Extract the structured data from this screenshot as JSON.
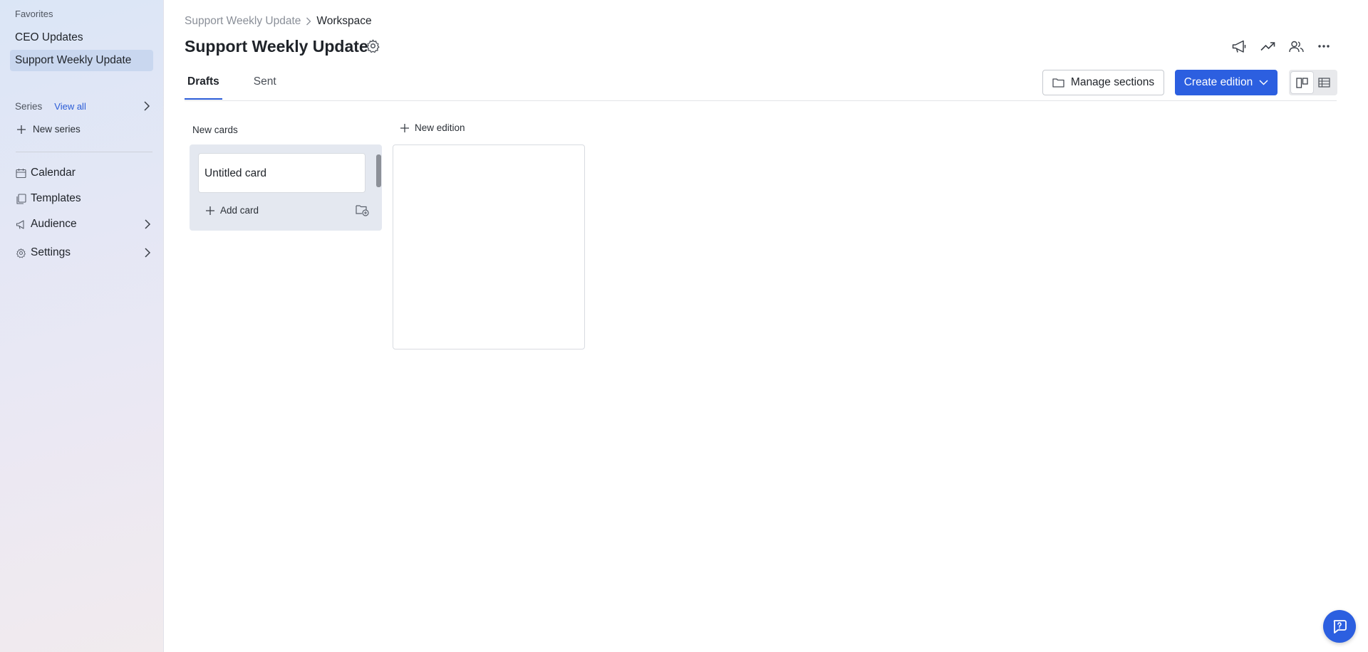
{
  "sidebar": {
    "favorites_heading": "Favorites",
    "favorites": [
      {
        "label": "CEO Updates",
        "selected": false
      },
      {
        "label": "Support Weekly Update",
        "selected": true
      }
    ],
    "series_label": "Series",
    "view_all_label": "View all",
    "new_series_label": "New series",
    "nav": [
      {
        "label": "Calendar",
        "icon": "calendar-icon"
      },
      {
        "label": "Templates",
        "icon": "templates-icon"
      },
      {
        "label": "Audience",
        "icon": "megaphone-icon"
      },
      {
        "label": "Settings",
        "icon": "gear-icon"
      }
    ]
  },
  "breadcrumb": {
    "parent": "Support Weekly Update",
    "current": "Workspace"
  },
  "page": {
    "title": "Support Weekly Update"
  },
  "header_icons": [
    "megaphone-icon",
    "trend-icon",
    "people-icon",
    "more-icon"
  ],
  "tabs": [
    {
      "label": "Drafts",
      "active": true
    },
    {
      "label": "Sent",
      "active": false
    }
  ],
  "toolbar": {
    "manage_sections_label": "Manage sections",
    "create_edition_label": "Create edition",
    "view_mode": "board"
  },
  "board": {
    "new_cards_heading": "New cards",
    "new_edition_label": "New edition",
    "cards": [
      {
        "title": "Untitled card"
      }
    ],
    "add_card_label": "Add card"
  },
  "colors": {
    "accent": "#2c5fe0",
    "selected_bg": "#c9d7ef",
    "column_bg": "#e4e8f0"
  }
}
